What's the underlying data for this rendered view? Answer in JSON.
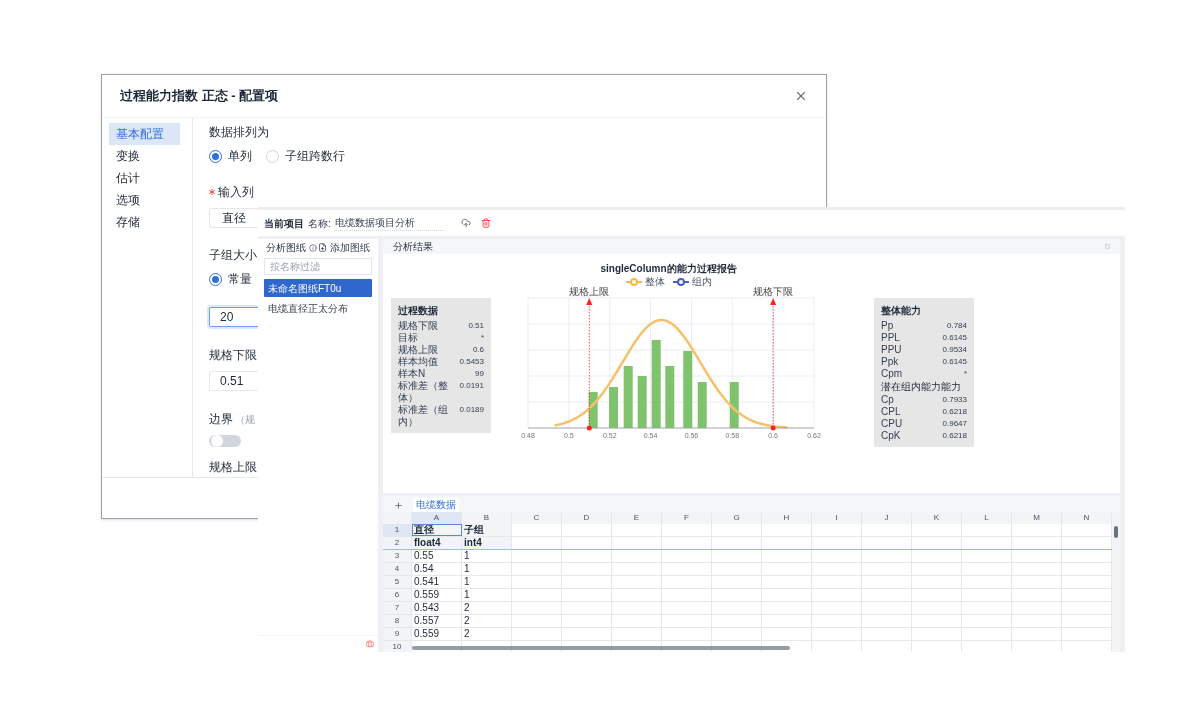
{
  "dialog": {
    "title": "过程能力指数 正态 - 配置项",
    "sidebar": [
      {
        "label": "基本配置",
        "selected": true
      },
      {
        "label": "变换",
        "selected": false
      },
      {
        "label": "估计",
        "selected": false
      },
      {
        "label": "选项",
        "selected": false
      },
      {
        "label": "存储",
        "selected": false
      }
    ],
    "form": [
      {
        "kind": "label",
        "text": "数据排列为"
      },
      {
        "kind": "radios",
        "options": [
          {
            "label": "单列",
            "selected": true
          },
          {
            "label": "子组跨数行",
            "selected": false
          }
        ]
      },
      {
        "kind": "label",
        "text": "输入列",
        "required": true
      },
      {
        "kind": "select",
        "value": "直径"
      },
      {
        "kind": "label",
        "text": "子组大小"
      },
      {
        "kind": "radios",
        "options": [
          {
            "label": "常量",
            "selected": true
          }
        ]
      },
      {
        "kind": "input",
        "value": "20",
        "focused": true
      },
      {
        "kind": "label",
        "text": "规格下限"
      },
      {
        "kind": "input",
        "value": "0.51",
        "focused": false
      },
      {
        "kind": "label",
        "text": "边界",
        "hint": "（规"
      },
      {
        "kind": "toggle",
        "on": false
      },
      {
        "kind": "label",
        "text": "规格上限"
      }
    ]
  },
  "app": {
    "project_label": "当前项目",
    "name_label": "名称:",
    "project_name": "电缆数据项目分析",
    "sidebar": {
      "title": "分析图纸",
      "add": "添加图纸",
      "filter_placeholder": "按名称过滤",
      "items": [
        {
          "label": "未命名图纸FT0u",
          "selected": true
        },
        {
          "label": "电缆直径正太分布",
          "selected": false
        }
      ]
    },
    "result": {
      "title": "分析结果",
      "process": {
        "title": "过程数据",
        "rows": [
          {
            "label": "规格下限",
            "value": "0.51"
          },
          {
            "label": "目标",
            "value": "*"
          },
          {
            "label": "规格上限",
            "value": "0.6"
          },
          {
            "label": "样本均值",
            "value": "0.5453"
          },
          {
            "label": "样本N",
            "value": "99"
          },
          {
            "label": "标准差（整体）",
            "value": "0.0191"
          },
          {
            "label": "标准差（组内）",
            "value": "0.0189"
          }
        ]
      },
      "chart": {
        "title": "singleColumn的能力过程报告",
        "legend": [
          {
            "label": "整体",
            "color": "#f5b94a"
          },
          {
            "label": "组内",
            "color": "#4a5fc1"
          }
        ],
        "spec_labels": [
          "规格上限",
          "规格下限"
        ],
        "xtick_labels": [
          "0.48",
          "0.5",
          "0.52",
          "0.54",
          "0.56",
          "0.58",
          "0.6",
          "0.62"
        ]
      },
      "capability": {
        "title": "整体能力",
        "items": [
          {
            "kind": "row",
            "label": "Pp",
            "value": "0.784"
          },
          {
            "kind": "row",
            "label": "PPL",
            "value": "0.6145"
          },
          {
            "kind": "row",
            "label": "PPU",
            "value": "0.9534"
          },
          {
            "kind": "row",
            "label": "Ppk",
            "value": "0.6145"
          },
          {
            "kind": "row",
            "label": "Cpm",
            "value": "*"
          },
          {
            "kind": "subheading",
            "label": "潜在组内能力能力"
          },
          {
            "kind": "row",
            "label": "Cp",
            "value": "0.7933"
          },
          {
            "kind": "row",
            "label": "CPL",
            "value": "0.6218"
          },
          {
            "kind": "row",
            "label": "CPU",
            "value": "0.9647"
          },
          {
            "kind": "row",
            "label": "CpK",
            "value": "0.6218"
          }
        ]
      }
    },
    "sheet": {
      "tabs": [
        {
          "label": "电缆数据",
          "selected": true
        }
      ],
      "columns": [
        "A",
        "B",
        "C",
        "D",
        "E",
        "F",
        "G",
        "H",
        "I",
        "J",
        "K",
        "L",
        "M",
        "N"
      ],
      "rows": [
        {
          "number": "1",
          "header": true,
          "cells": [
            {
              "text": "直径",
              "selected": true
            },
            {
              "text": "子组",
              "selected": false
            }
          ]
        },
        {
          "number": "2",
          "header": true,
          "cells": [
            {
              "text": "float4",
              "selected": false
            },
            {
              "text": "int4",
              "selected": false
            }
          ]
        },
        {
          "number": "3",
          "cells": [
            {
              "text": "0.55",
              "selected": false
            },
            {
              "text": "1",
              "selected": false
            }
          ]
        },
        {
          "number": "4",
          "cells": [
            {
              "text": "0.54",
              "selected": false
            },
            {
              "text": "1",
              "selected": false
            }
          ]
        },
        {
          "number": "5",
          "cells": [
            {
              "text": "0.541",
              "selected": false
            },
            {
              "text": "1",
              "selected": false
            }
          ]
        },
        {
          "number": "6",
          "cells": [
            {
              "text": "0.559",
              "selected": false
            },
            {
              "text": "1",
              "selected": false
            }
          ]
        },
        {
          "number": "7",
          "cells": [
            {
              "text": "0.543",
              "selected": false
            },
            {
              "text": "2",
              "selected": false
            }
          ]
        },
        {
          "number": "8",
          "cells": [
            {
              "text": "0.557",
              "selected": false
            },
            {
              "text": "2",
              "selected": false
            }
          ]
        },
        {
          "number": "9",
          "cells": [
            {
              "text": "0.559",
              "selected": false
            },
            {
              "text": "2",
              "selected": false
            }
          ]
        },
        {
          "number": "10"
        }
      ]
    }
  }
}
